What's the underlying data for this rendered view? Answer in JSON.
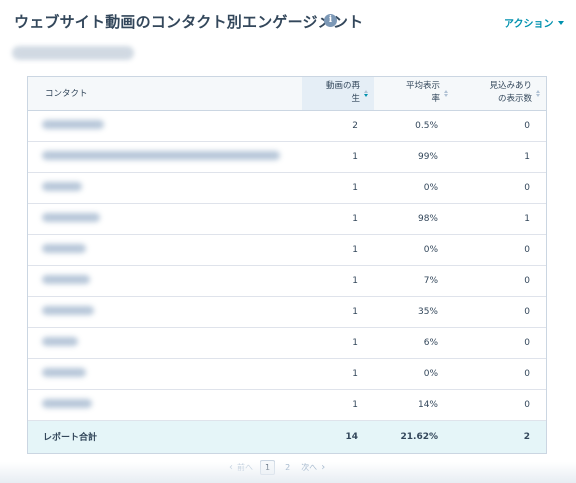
{
  "header": {
    "title": "ウェブサイト動画のコンタクト別エンゲージメント",
    "info_icon": "info-icon",
    "actions_label": "アクション"
  },
  "table": {
    "columns": {
      "contact": "コンタクト",
      "plays": "動画の再\n生",
      "avg_view_rate": "平均表示\n率",
      "potential_views": "見込みあり\nの表示数"
    },
    "rows": [
      {
        "plays": "2",
        "avg_view_rate": "0.5%",
        "potential_views": "0"
      },
      {
        "plays": "1",
        "avg_view_rate": "99%",
        "potential_views": "1"
      },
      {
        "plays": "1",
        "avg_view_rate": "0%",
        "potential_views": "0"
      },
      {
        "plays": "1",
        "avg_view_rate": "98%",
        "potential_views": "1"
      },
      {
        "plays": "1",
        "avg_view_rate": "0%",
        "potential_views": "0"
      },
      {
        "plays": "1",
        "avg_view_rate": "7%",
        "potential_views": "0"
      },
      {
        "plays": "1",
        "avg_view_rate": "35%",
        "potential_views": "0"
      },
      {
        "plays": "1",
        "avg_view_rate": "6%",
        "potential_views": "0"
      },
      {
        "plays": "1",
        "avg_view_rate": "0%",
        "potential_views": "0"
      },
      {
        "plays": "1",
        "avg_view_rate": "14%",
        "potential_views": "0"
      }
    ],
    "total": {
      "label": "レポート合計",
      "plays": "14",
      "avg_view_rate": "21.62%",
      "potential_views": "2"
    }
  },
  "pagination": {
    "prev_label": "前へ",
    "pages": [
      "1",
      "2"
    ],
    "current_page": "1",
    "next_label": "次へ"
  },
  "colors": {
    "accent": "#0091ae",
    "text": "#33475b",
    "header_bg": "#f5f8fa",
    "total_bg": "#e5f5f8"
  }
}
